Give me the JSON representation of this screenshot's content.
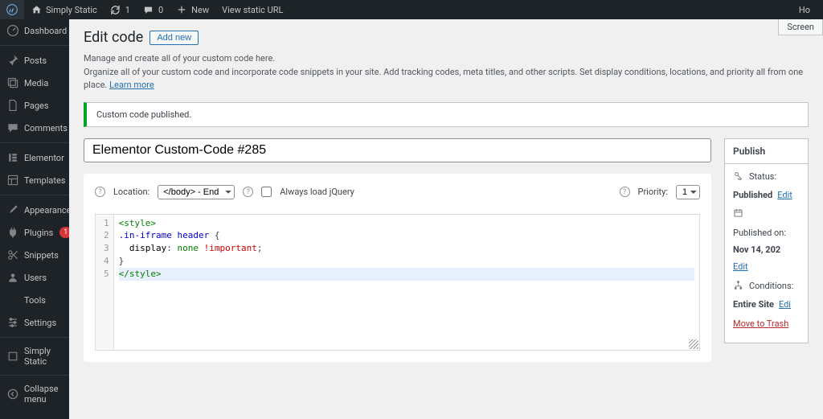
{
  "adminbar": {
    "site_name": "Simply Static",
    "updates": "1",
    "comments": "0",
    "new_label": "New",
    "view_static": "View static URL",
    "howdy": "Ho"
  },
  "sidebar": {
    "dashboard": "Dashboard",
    "posts": "Posts",
    "media": "Media",
    "pages": "Pages",
    "comments": "Comments",
    "elementor": "Elementor",
    "templates": "Templates",
    "appearance": "Appearance",
    "plugins": "Plugins",
    "plugins_badge": "1",
    "snippets": "Snippets",
    "users": "Users",
    "tools": "Tools",
    "settings": "Settings",
    "simply_static": "Simply Static",
    "collapse": "Collapse menu"
  },
  "screen_options": "Screen",
  "page": {
    "title": "Edit code",
    "add_new": "Add new",
    "desc1": "Manage and create all of your custom code here.",
    "desc2": "Organize all of your custom code and incorporate code snippets in your site. Add tracking codes, meta titles, and other scripts. Set display conditions, locations, and priority all from one place. ",
    "learn_more": "Learn more"
  },
  "notice": "Custom code published.",
  "title_input": "Elementor Custom-Code #285",
  "options": {
    "location_label": "Location:",
    "location_value": "</body> - End",
    "always_jquery": "Always load jQuery",
    "priority_label": "Priority:",
    "priority_value": "1"
  },
  "code": {
    "lines": [
      "1",
      "2",
      "3",
      "4",
      "5"
    ],
    "l1_tag": "<style>",
    "l2_sel": ".in-iframe",
    "l2_sel2": "header",
    "l2_brace": " {",
    "l3_indent": "  ",
    "l3_prop": "display",
    "l3_colon": ": ",
    "l3_val": "none",
    "l3_space": " ",
    "l3_imp": "!important",
    "l3_semi": ";",
    "l4": "}",
    "l5_tag": "</style>"
  },
  "publish": {
    "title": "Publish",
    "status_label": "Status:",
    "status_value": "Published",
    "status_edit": "Edit",
    "published_on_label": "Published on:",
    "published_on_value": "Nov 14, 202",
    "published_edit": "Edit",
    "conditions_label": "Conditions:",
    "conditions_value": "Entire Site",
    "conditions_edit": "Edi",
    "move_trash": "Move to Trash"
  }
}
